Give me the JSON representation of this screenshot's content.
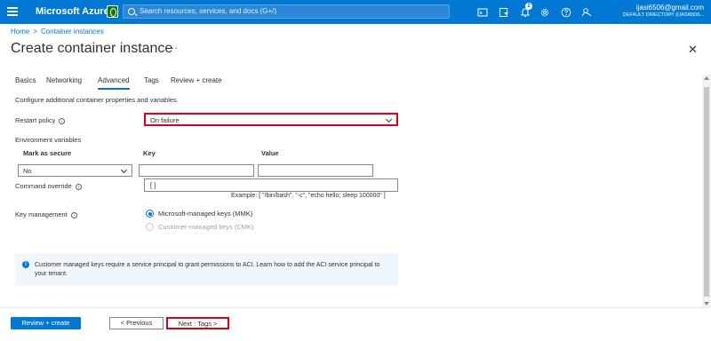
{
  "topbar": {
    "brand": "Microsoft Azure",
    "search_placeholder": "Search resources, services, and docs (G+/)",
    "notification_count": "2",
    "account_email": "ijasi6506@gmail.com",
    "account_directory": "DEFAULT DIRECTORY (IJASI6506..."
  },
  "breadcrumb": {
    "home": "Home",
    "section": "Container instances"
  },
  "page": {
    "title": "Create container instance",
    "more": "···",
    "close": "✕"
  },
  "tabs": [
    {
      "label": "Basics"
    },
    {
      "label": "Networking"
    },
    {
      "label": "Advanced"
    },
    {
      "label": "Tags"
    },
    {
      "label": "Review + create"
    }
  ],
  "form": {
    "intro": "Configure additional container properties and variables.",
    "restart_policy_label": "Restart policy",
    "restart_policy_value": "On failure",
    "env_vars_label": "Environment variables",
    "col_mark_secure": "Mark as secure",
    "col_key": "Key",
    "col_value": "Value",
    "secure_value": "No",
    "key_value": "",
    "value_value": "",
    "command_override_label": "Command override",
    "command_override_value": "[ ]",
    "command_example": "Example: [ \"/bin/bash\", \"-c\", \"echo hello; sleep 100000\" ]",
    "key_management_label": "Key management",
    "option_mmk": "Microsoft-managed keys (MMK)",
    "option_cmk": "Customer-managed keys (CMK)"
  },
  "info_banner": "Customer managed keys require a service principal to grant permissions to ACI. Learn how to add the ACI service principal to your tenant.",
  "footer": {
    "review_create": "Review + create",
    "previous": "< Previous",
    "next": "Next : Tags >"
  },
  "colors": {
    "accent": "#0078d4",
    "highlight": "#d9001b",
    "info_bg": "#eff6fc"
  }
}
